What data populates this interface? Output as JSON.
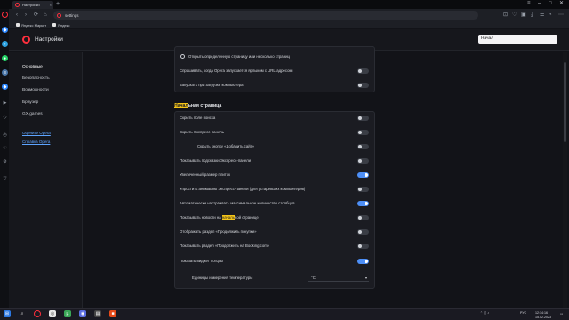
{
  "browser": {
    "tab": {
      "title": "Настройки",
      "close": "×"
    },
    "new_tab": "+",
    "window_controls": {
      "sidebar": "≡",
      "minimize": "–",
      "maximize": "□",
      "close": "✕"
    },
    "nav": {
      "back": "‹",
      "forward": "›",
      "reload": "⟳",
      "home": "⌂"
    },
    "address": "settings",
    "bookmarks": [
      {
        "label": "Яндекс Маркет"
      },
      {
        "label": "Яндекс"
      }
    ]
  },
  "header": {
    "title": "Настройки",
    "search_value": "Начал"
  },
  "nav": {
    "items": [
      {
        "label": "Основные",
        "active": true
      },
      {
        "label": "Безопасность"
      },
      {
        "label": "Возможности"
      },
      {
        "label": "Браузер"
      },
      {
        "label": "GX.games"
      }
    ],
    "links": [
      {
        "label": "Оцените Opera"
      },
      {
        "label": "Справка Opera"
      }
    ]
  },
  "startup": {
    "radio_label": "Открыть определенную страницу или несколько страниц",
    "rows": [
      {
        "label": "Спрашивать, когда Opera запускается ярлыком с URL-адресом",
        "on": false
      },
      {
        "label": "Запускать при загрузке компьютера",
        "on": false
      }
    ]
  },
  "start_page": {
    "title_highlight": "Начал",
    "title_rest": "ьная страница",
    "rows": [
      {
        "label": "Скрыть поле поиска",
        "on": false
      },
      {
        "label": "Скрыть Экспресс-панель",
        "on": false
      },
      {
        "label": "Скрыть кнопку «Добавить сайт»",
        "on": false,
        "indent": true
      },
      {
        "label": "Показывать подсказки Экспресс-панели",
        "on": false
      },
      {
        "label": "Увеличенный размер плиток",
        "on": true
      },
      {
        "label": "Упростить анимацию Экспресс-панели (для устаревших компьютеров)",
        "on": false
      },
      {
        "label": "Автоматически настраивать максимальное количество столбцов",
        "on": true
      },
      {
        "label": "Показывать новости на ",
        "highlight": "началь",
        "label_rest": "ной странице",
        "on": false
      },
      {
        "label": "Отображать раздел «Продолжить покупки»",
        "on": false
      },
      {
        "label": "Показывать раздел «Продолжить на Booking.com»",
        "on": false
      },
      {
        "label": "Показать виджет погоды",
        "on": true
      }
    ],
    "temperature": {
      "label": "Единицы измерения температуры",
      "value": "°C"
    }
  },
  "taskbar": {
    "tray": {
      "lang": "РУС",
      "time": "12:14:16",
      "date": "15.02.2023"
    }
  },
  "colors": {
    "accent": "#4d8ff7",
    "opera_red": "#ff2f3d",
    "highlight": "#f5c518"
  }
}
